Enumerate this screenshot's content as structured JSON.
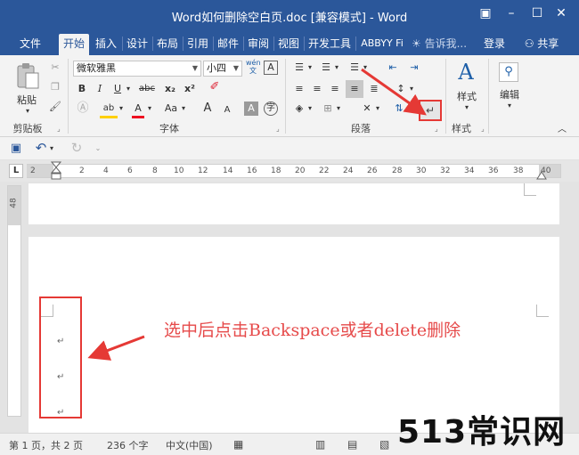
{
  "window": {
    "title": "Word如何删除空白页.doc [兼容模式] - Word",
    "buttons": {
      "ribbon_display": "▣",
      "minimize": "–",
      "maximize": "☐",
      "close": "✕"
    }
  },
  "tabs": [
    {
      "label": "文件",
      "active": false
    },
    {
      "label": "开始",
      "active": true
    },
    {
      "label": "插入",
      "active": false
    },
    {
      "label": "设计",
      "active": false
    },
    {
      "label": "布局",
      "active": false
    },
    {
      "label": "引用",
      "active": false
    },
    {
      "label": "邮件",
      "active": false
    },
    {
      "label": "审阅",
      "active": false
    },
    {
      "label": "视图",
      "active": false
    },
    {
      "label": "开发工具",
      "active": false
    },
    {
      "label": "ABBYY Fi",
      "active": false
    }
  ],
  "tellme": {
    "icon": "lightbulb-icon",
    "placeholder": "告诉我..."
  },
  "login": "登录",
  "share": "共享",
  "ribbon": {
    "clipboard": {
      "label": "剪贴板",
      "paste": "粘贴"
    },
    "font": {
      "label": "字体",
      "font_name": "微软雅黑",
      "font_size": "小四",
      "phonetic": "wén\n文",
      "bold": "B",
      "italic": "I",
      "underline": "U",
      "strike": "abc",
      "subscript": "x₂",
      "superscript": "x²",
      "font_color": "A",
      "change_case": "Aa",
      "grow": "A",
      "shrink": "A",
      "char_shading": "A",
      "enclose": "字"
    },
    "paragraph": {
      "label": "段落"
    },
    "styles": {
      "label": "样式",
      "button": "样式"
    },
    "editing": {
      "button": "编辑"
    }
  },
  "ruler": {
    "corner": "L",
    "ticks": [
      "2",
      "2",
      "4",
      "6",
      "8",
      "10",
      "12",
      "14",
      "16",
      "18",
      "20",
      "22",
      "24",
      "26",
      "28",
      "30",
      "32",
      "34",
      "36",
      "38",
      "40"
    ]
  },
  "vruler": {
    "tick": "48"
  },
  "paragraph_mark": "↵",
  "annotation": "选中后点击Backspace或者delete删除",
  "status": {
    "page": "第 1 页，共 2 页",
    "words": "236 个字",
    "language": "中文(中国)"
  },
  "watermark": "513常识网",
  "colors": {
    "accent": "#2b579a",
    "highlight": "#e53935"
  }
}
